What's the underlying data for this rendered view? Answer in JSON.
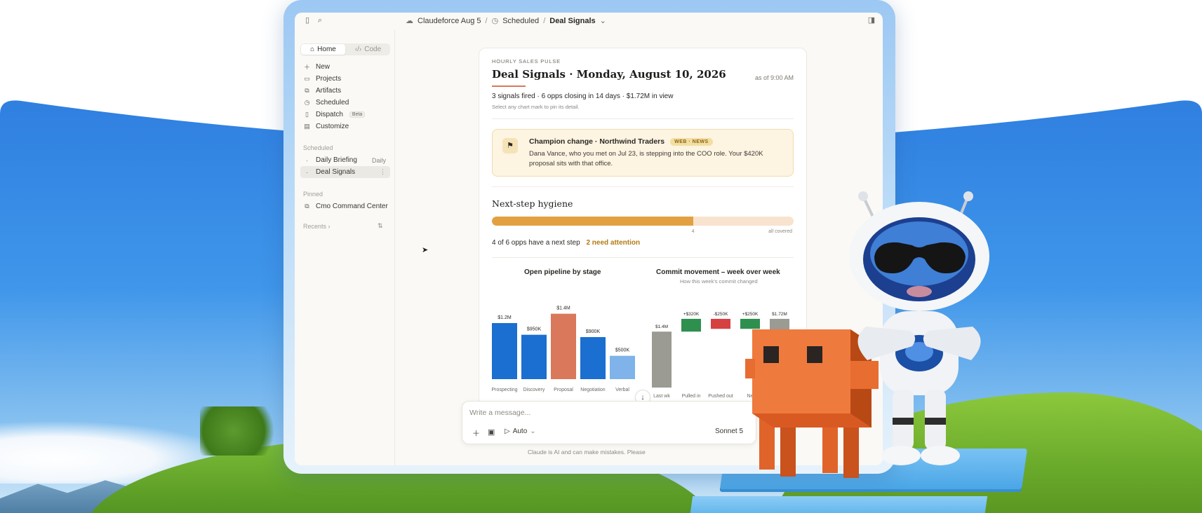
{
  "topbar": {
    "breadcrumb": {
      "workspace": "Claudeforce Aug 5",
      "section": "Scheduled",
      "current": "Deal Signals"
    }
  },
  "sidebar": {
    "tabs": [
      {
        "label": "Home",
        "icon": "home-icon",
        "active": true
      },
      {
        "label": "Code",
        "icon": "code-icon",
        "active": false
      }
    ],
    "nav": [
      {
        "label": "New",
        "icon": "plus-icon"
      },
      {
        "label": "Projects",
        "icon": "folder-icon"
      },
      {
        "label": "Artifacts",
        "icon": "artifacts-icon"
      },
      {
        "label": "Scheduled",
        "icon": "clock-icon"
      },
      {
        "label": "Dispatch",
        "icon": "dispatch-icon",
        "badge": "Beta"
      },
      {
        "label": "Customize",
        "icon": "briefcase-icon"
      }
    ],
    "scheduled_label": "Scheduled",
    "scheduled": [
      {
        "label": "Daily Briefing",
        "meta": "Daily"
      },
      {
        "label": "Deal Signals",
        "meta": "⋮",
        "selected": true
      }
    ],
    "pinned_label": "Pinned",
    "pinned": [
      {
        "label": "Cmo Command Center",
        "icon": "artifacts-icon"
      }
    ],
    "recents_label": "Recents ›"
  },
  "report": {
    "eyebrow": "HOURLY SALES PULSE",
    "title": "Deal Signals · Monday, August 10, 2026",
    "as_of": "as of 9:00 AM",
    "summary": "3 signals fired · 6 opps closing in 14 days · $1.72M in view",
    "hint": "Select any chart mark to pin its detail.",
    "alert": {
      "title": "Champion change · Northwind Traders",
      "tag": "WEB · NEWS",
      "body": "Dana Vance, who you met on Jul 23, is stepping into the COO role. Your $420K proposal sits with that office."
    },
    "hygiene": {
      "heading": "Next-step hygiene",
      "covered": 4,
      "total": 6,
      "marker_label": "4",
      "end_label": "all covered",
      "text": "4 of 6 opps have a next step",
      "attention": "2 need attention"
    }
  },
  "chart_data": [
    {
      "type": "bar",
      "title": "Open pipeline by stage",
      "categories": [
        "Prospecting",
        "Discovery",
        "Proposal",
        "Negotiation",
        "Verbal"
      ],
      "values": [
        1.2,
        0.95,
        1.4,
        0.9,
        0.5
      ],
      "value_labels": [
        "$1.2M",
        "$950K",
        "$1.4M",
        "$900K",
        "$500K"
      ],
      "colors": [
        "#1a6fd0",
        "#1a6fd0",
        "#d9785a",
        "#1a6fd0",
        "#7fb3ea"
      ],
      "ylim": [
        0,
        1.5
      ]
    },
    {
      "type": "bar",
      "title": "Commit movement – week over week",
      "subtitle": "How this week's commit changed",
      "categories": [
        "Last wk",
        "Pulled in",
        "Pushed out",
        "Ne",
        ""
      ],
      "values": [
        1.4,
        0.32,
        -0.25,
        0.25,
        1.72
      ],
      "value_labels": [
        "$1.4M",
        "+$320K",
        "-$250K",
        "+$250K",
        "$1.72M"
      ],
      "colors": [
        "#9b9a93",
        "#2f8f4e",
        "#d64141",
        "#2f8f4e",
        "#9b9a93"
      ],
      "ylim": [
        0,
        2.0
      ]
    }
  ],
  "composer": {
    "placeholder": "Write a message...",
    "mode": "Auto",
    "model": "Sonnet 5",
    "disclaimer": "Claude is AI and can make mistakes. Please"
  },
  "colors": {
    "accent": "#d9785a",
    "bar_blue": "#1a6fd0",
    "hygiene_fill": "#e3a041",
    "alert_bg": "#fdf4e2"
  }
}
